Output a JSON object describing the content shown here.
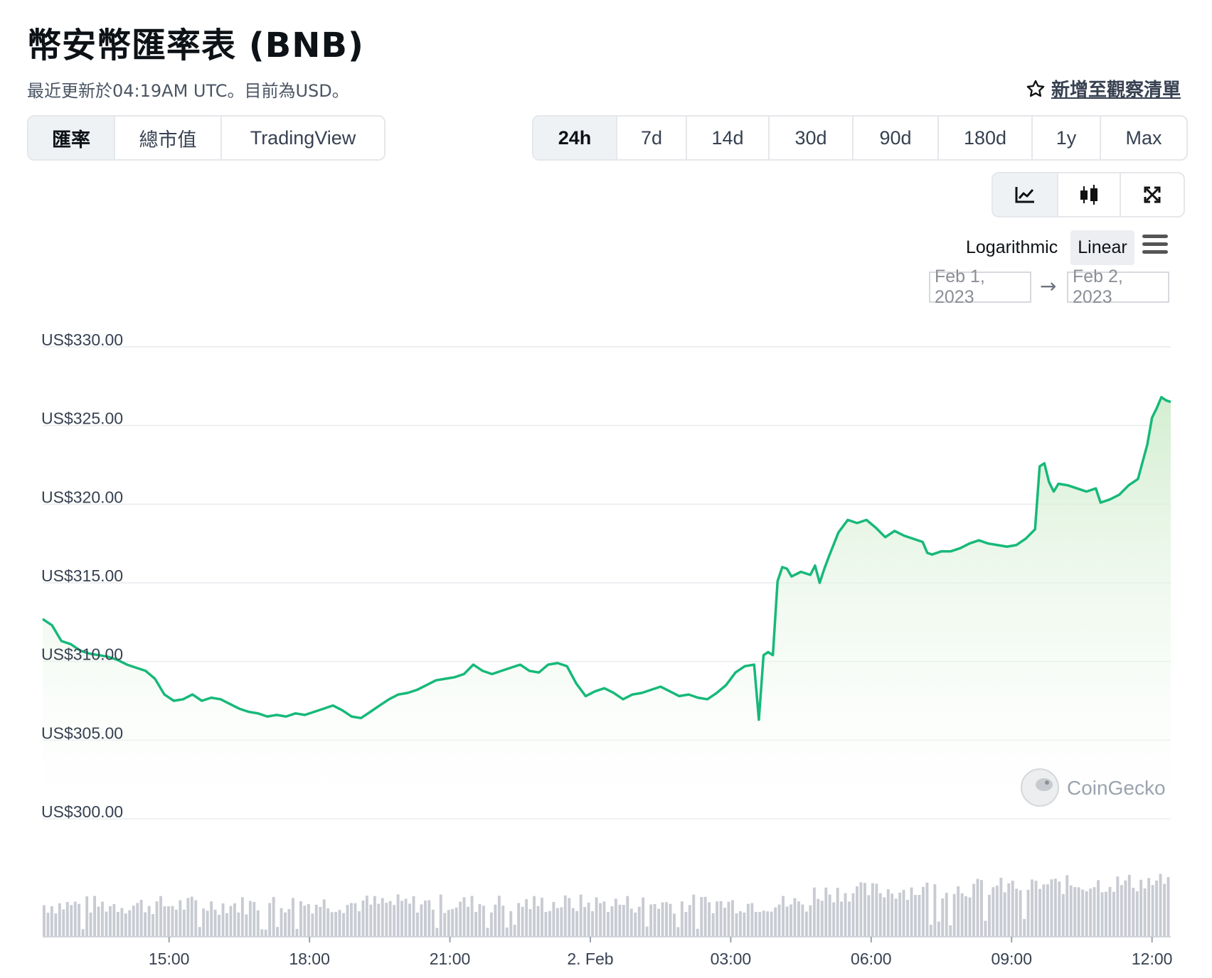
{
  "header": {
    "title": "幣安幣匯率表 (BNB)",
    "subtitle": "最近更新於04:19AM UTC。目前為USD。",
    "watchlist_label": "新增至觀察清單"
  },
  "tabs": [
    {
      "label": "匯率",
      "active": true
    },
    {
      "label": "總市值",
      "active": false
    },
    {
      "label": "TradingView",
      "active": false
    }
  ],
  "ranges": [
    {
      "label": "24h",
      "active": true
    },
    {
      "label": "7d",
      "active": false
    },
    {
      "label": "14d",
      "active": false
    },
    {
      "label": "30d",
      "active": false
    },
    {
      "label": "90d",
      "active": false
    },
    {
      "label": "180d",
      "active": false
    },
    {
      "label": "1y",
      "active": false
    },
    {
      "label": "Max",
      "active": false
    }
  ],
  "view_icons": [
    "line-chart-icon",
    "candlestick-icon",
    "fullscreen-icon"
  ],
  "scale": {
    "logarithmic": "Logarithmic",
    "linear": "Linear",
    "selected": "Linear"
  },
  "date_range": {
    "from": "Feb 1, 2023",
    "to": "Feb 2, 2023"
  },
  "brand": "CoinGecko",
  "colors": {
    "line": "#16b979",
    "fill": "#d8f0d6",
    "volume": "#c8cbd2",
    "grid": "#e8eaed"
  },
  "chart_data": {
    "type": "area",
    "y_unit": "US$",
    "ylim": [
      300,
      330
    ],
    "y_ticks": [
      "US$330.00",
      "US$325.00",
      "US$320.00",
      "US$315.00",
      "US$310.00",
      "US$305.00",
      "US$300.00"
    ],
    "y_tick_values": [
      330,
      325,
      320,
      315,
      310,
      305,
      300
    ],
    "x_ticks": [
      "15:00",
      "18:00",
      "21:00",
      "2. Feb",
      "03:00",
      "06:00",
      "09:00",
      "12:00"
    ],
    "x_tick_hours": [
      15,
      18,
      21,
      24,
      27,
      30,
      33,
      36
    ],
    "x_range_hours": [
      12.3,
      36.4
    ],
    "series": [
      {
        "points": [
          [
            12.3,
            312.7
          ],
          [
            12.5,
            312.3
          ],
          [
            12.7,
            311.3
          ],
          [
            12.9,
            311.1
          ],
          [
            13.1,
            310.7
          ],
          [
            13.3,
            310.5
          ],
          [
            13.5,
            310.4
          ],
          [
            13.7,
            310.3
          ],
          [
            13.9,
            310.1
          ],
          [
            14.1,
            309.8
          ],
          [
            14.3,
            309.6
          ],
          [
            14.5,
            309.4
          ],
          [
            14.7,
            308.9
          ],
          [
            14.9,
            307.9
          ],
          [
            15.1,
            307.5
          ],
          [
            15.3,
            307.6
          ],
          [
            15.5,
            307.9
          ],
          [
            15.7,
            307.5
          ],
          [
            15.9,
            307.7
          ],
          [
            16.1,
            307.6
          ],
          [
            16.3,
            307.3
          ],
          [
            16.5,
            307.0
          ],
          [
            16.7,
            306.8
          ],
          [
            16.9,
            306.7
          ],
          [
            17.1,
            306.5
          ],
          [
            17.3,
            306.6
          ],
          [
            17.5,
            306.5
          ],
          [
            17.7,
            306.7
          ],
          [
            17.9,
            306.6
          ],
          [
            18.1,
            306.8
          ],
          [
            18.3,
            307.0
          ],
          [
            18.5,
            307.2
          ],
          [
            18.7,
            306.9
          ],
          [
            18.9,
            306.5
          ],
          [
            19.1,
            306.4
          ],
          [
            19.3,
            306.8
          ],
          [
            19.5,
            307.2
          ],
          [
            19.7,
            307.6
          ],
          [
            19.9,
            307.9
          ],
          [
            20.1,
            308.0
          ],
          [
            20.3,
            308.2
          ],
          [
            20.5,
            308.5
          ],
          [
            20.7,
            308.8
          ],
          [
            20.9,
            308.9
          ],
          [
            21.1,
            309.0
          ],
          [
            21.3,
            309.2
          ],
          [
            21.5,
            309.8
          ],
          [
            21.7,
            309.4
          ],
          [
            21.9,
            309.2
          ],
          [
            22.1,
            309.4
          ],
          [
            22.3,
            309.6
          ],
          [
            22.5,
            309.8
          ],
          [
            22.7,
            309.4
          ],
          [
            22.9,
            309.3
          ],
          [
            23.1,
            309.8
          ],
          [
            23.3,
            309.9
          ],
          [
            23.5,
            309.7
          ],
          [
            23.7,
            308.6
          ],
          [
            23.9,
            307.8
          ],
          [
            24.1,
            308.1
          ],
          [
            24.3,
            308.3
          ],
          [
            24.5,
            308.0
          ],
          [
            24.7,
            307.6
          ],
          [
            24.9,
            307.9
          ],
          [
            25.1,
            308.0
          ],
          [
            25.3,
            308.2
          ],
          [
            25.5,
            308.4
          ],
          [
            25.7,
            308.1
          ],
          [
            25.9,
            307.8
          ],
          [
            26.1,
            307.9
          ],
          [
            26.3,
            307.7
          ],
          [
            26.5,
            307.6
          ],
          [
            26.7,
            308.0
          ],
          [
            26.9,
            308.5
          ],
          [
            27.1,
            309.3
          ],
          [
            27.3,
            309.7
          ],
          [
            27.5,
            309.8
          ],
          [
            27.6,
            306.3
          ],
          [
            27.7,
            310.4
          ],
          [
            27.8,
            310.6
          ],
          [
            27.9,
            310.4
          ],
          [
            28.0,
            315.1
          ],
          [
            28.1,
            316.0
          ],
          [
            28.2,
            315.9
          ],
          [
            28.3,
            315.4
          ],
          [
            28.5,
            315.7
          ],
          [
            28.7,
            315.5
          ],
          [
            28.8,
            316.1
          ],
          [
            28.9,
            315.0
          ],
          [
            29.0,
            315.9
          ],
          [
            29.1,
            316.7
          ],
          [
            29.3,
            318.2
          ],
          [
            29.5,
            319.0
          ],
          [
            29.7,
            318.8
          ],
          [
            29.9,
            319.0
          ],
          [
            30.1,
            318.5
          ],
          [
            30.3,
            317.9
          ],
          [
            30.5,
            318.3
          ],
          [
            30.7,
            318.0
          ],
          [
            30.9,
            317.8
          ],
          [
            31.1,
            317.6
          ],
          [
            31.2,
            316.9
          ],
          [
            31.3,
            316.8
          ],
          [
            31.5,
            317.0
          ],
          [
            31.7,
            317.0
          ],
          [
            31.9,
            317.2
          ],
          [
            32.1,
            317.5
          ],
          [
            32.3,
            317.7
          ],
          [
            32.5,
            317.5
          ],
          [
            32.7,
            317.4
          ],
          [
            32.9,
            317.3
          ],
          [
            33.1,
            317.4
          ],
          [
            33.3,
            317.8
          ],
          [
            33.5,
            318.4
          ],
          [
            33.6,
            322.4
          ],
          [
            33.7,
            322.6
          ],
          [
            33.8,
            321.4
          ],
          [
            33.9,
            320.8
          ],
          [
            34.0,
            321.3
          ],
          [
            34.2,
            321.2
          ],
          [
            34.4,
            321.0
          ],
          [
            34.6,
            320.8
          ],
          [
            34.8,
            321.0
          ],
          [
            34.9,
            320.1
          ],
          [
            35.1,
            320.3
          ],
          [
            35.3,
            320.6
          ],
          [
            35.5,
            321.2
          ],
          [
            35.7,
            321.6
          ],
          [
            35.9,
            323.8
          ],
          [
            36.0,
            325.5
          ],
          [
            36.1,
            326.1
          ],
          [
            36.2,
            326.8
          ],
          [
            36.3,
            326.6
          ],
          [
            36.4,
            326.5
          ]
        ]
      }
    ]
  }
}
